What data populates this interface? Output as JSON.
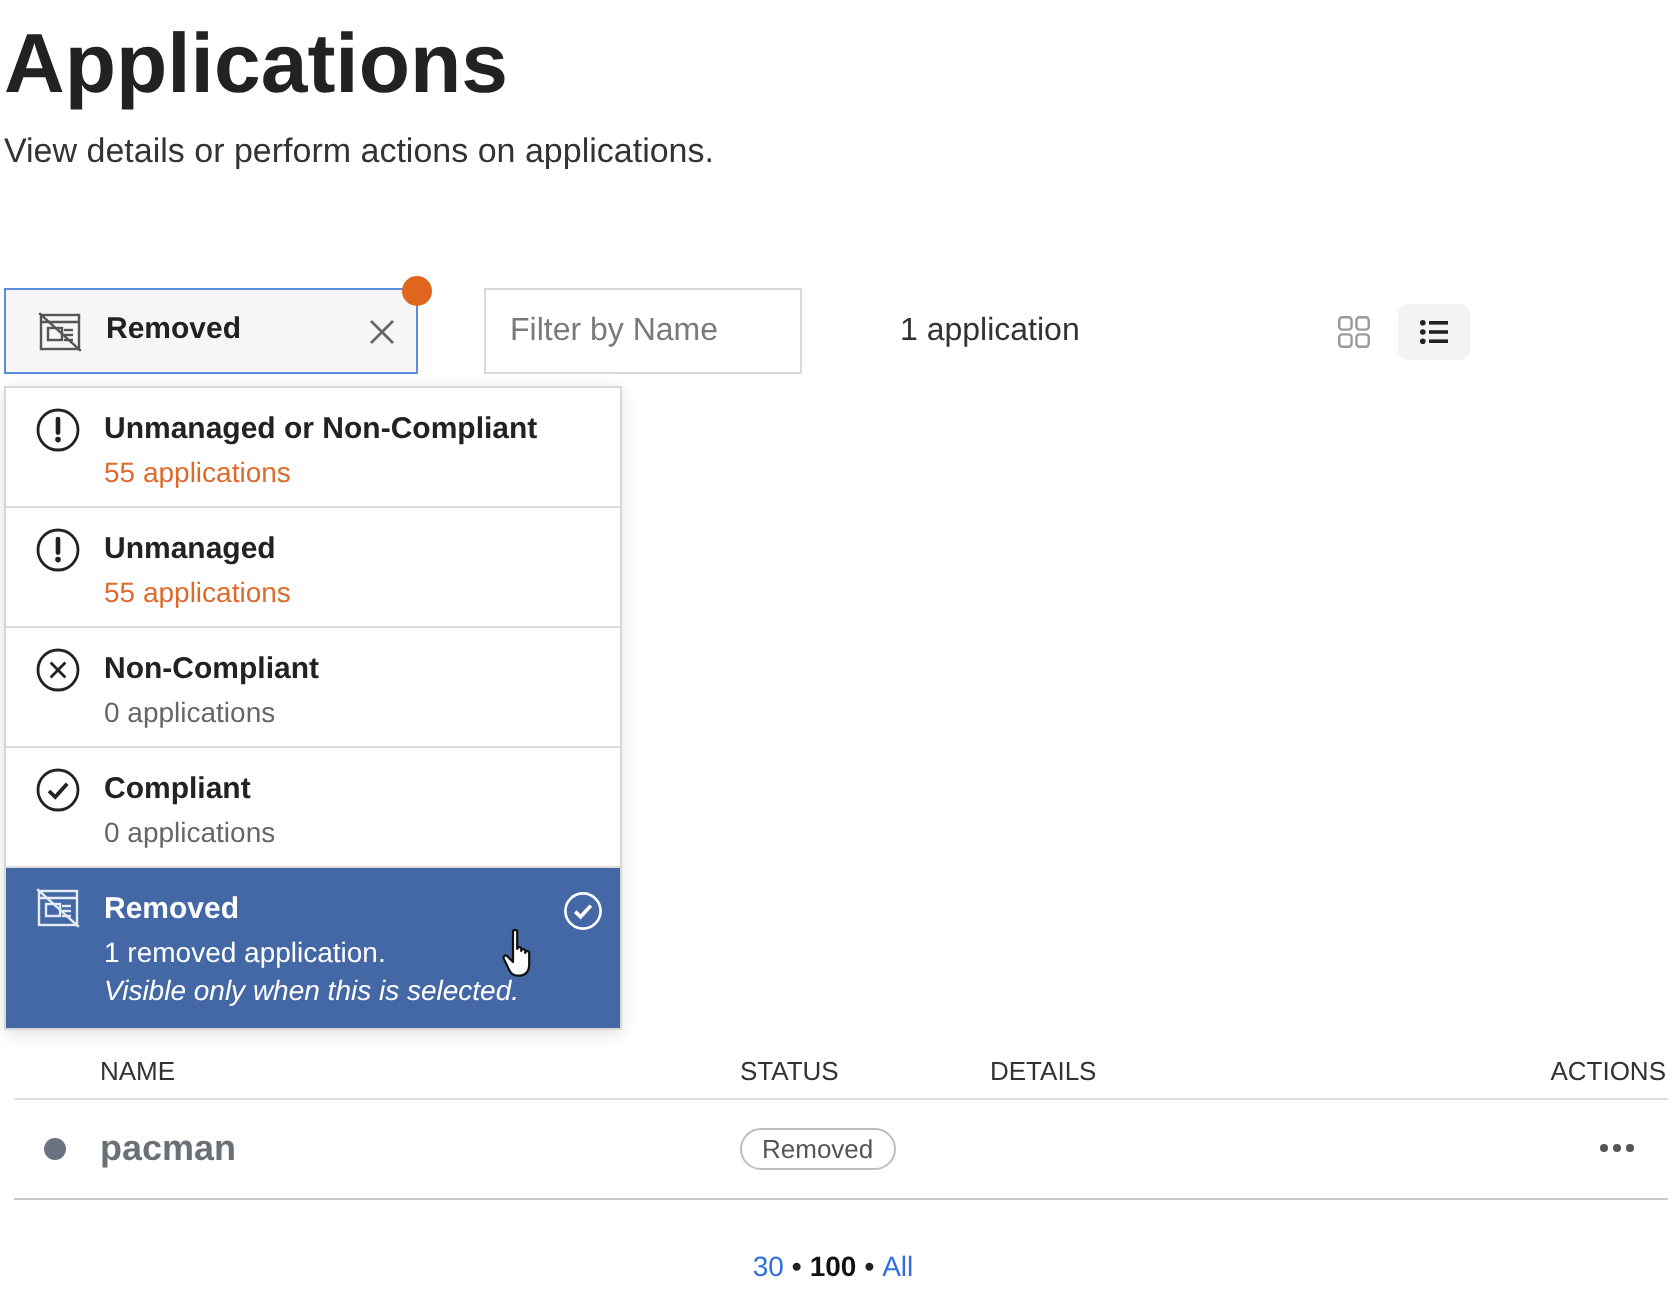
{
  "page": {
    "title": "Applications",
    "subtitle": "View details or perform actions on applications."
  },
  "status_filter": {
    "kind": "removed",
    "label": "Removed",
    "dot": true,
    "open": true,
    "options": [
      {
        "kind": "exclamation",
        "label": "Unmanaged or Non-Compliant",
        "count": "55 applications",
        "warning": true,
        "selected": false
      },
      {
        "kind": "exclamation",
        "label": "Unmanaged",
        "count": "55 applications",
        "warning": true,
        "selected": false
      },
      {
        "kind": "cross",
        "label": "Non-Compliant",
        "count": "0 applications",
        "warning": false,
        "selected": false
      },
      {
        "kind": "check",
        "label": "Compliant",
        "count": "0 applications",
        "warning": false,
        "selected": false
      },
      {
        "kind": "removed",
        "label": "Removed",
        "count": "1 removed application.",
        "note": "Visible only when this is selected.",
        "warning": false,
        "selected": true
      }
    ]
  },
  "name_filter": {
    "placeholder": "Filter by Name"
  },
  "result_count": "1 application",
  "view_modes": [
    {
      "kind": "grid",
      "selected": false
    },
    {
      "kind": "list",
      "selected": true
    }
  ],
  "table": {
    "columns": [
      "NAME",
      "STATUS",
      "DETAILS",
      "ACTIONS"
    ],
    "rows": [
      {
        "color": "#6b7280",
        "name": "pacman",
        "status": "Removed"
      }
    ]
  },
  "pagination": {
    "items": [
      {
        "label": "30",
        "selected": false
      },
      {
        "label": "100",
        "selected": true
      },
      {
        "label": "All",
        "selected": false
      }
    ],
    "separators": [
      "•",
      "•"
    ]
  }
}
